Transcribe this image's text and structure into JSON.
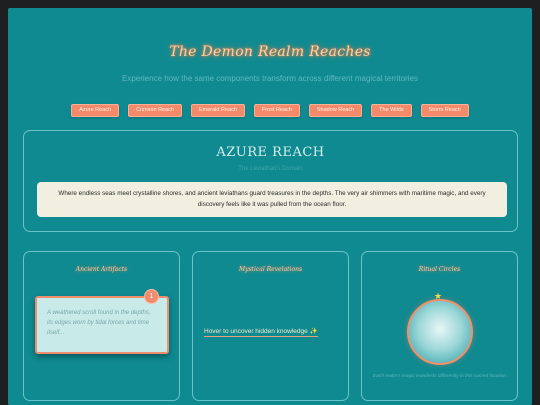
{
  "header": {
    "title": "The Demon Realm Reaches",
    "subtitle": "Experience how the same components transform across different magical territories"
  },
  "nav": {
    "items": [
      {
        "label": "Azure Reach"
      },
      {
        "label": "Crimson Reach"
      },
      {
        "label": "Emerald Reach"
      },
      {
        "label": "Frost Reach"
      },
      {
        "label": "Shadow Reach"
      },
      {
        "label": "The Wilds"
      },
      {
        "label": "Storm Reach"
      }
    ]
  },
  "hero": {
    "title": "AZURE REACH",
    "subtitle": "The Leviathan's Domain",
    "description": "Where endless seas meet crystalline shores, and ancient leviathans guard treasures in the depths. The very air shimmers with maritime magic, and every discovery feels like it was pulled from the ocean floor."
  },
  "cards": {
    "artifacts": {
      "title": "Ancient Artifacts",
      "scroll_text": "A weathered scroll found in the depths, its edges worn by tidal forces and time itself...",
      "badge": "1"
    },
    "revelations": {
      "title": "Mystical Revelations",
      "link_text": "Hover to uncover hidden knowledge ✨"
    },
    "ritual": {
      "title": "Ritual Circles",
      "star_icon": "★",
      "caption": "Each realm's magic manifests differently in this sacred location"
    }
  },
  "colors": {
    "background": "#0f8a91",
    "accent": "#f58a6a",
    "glow": "#ffd0a4"
  }
}
